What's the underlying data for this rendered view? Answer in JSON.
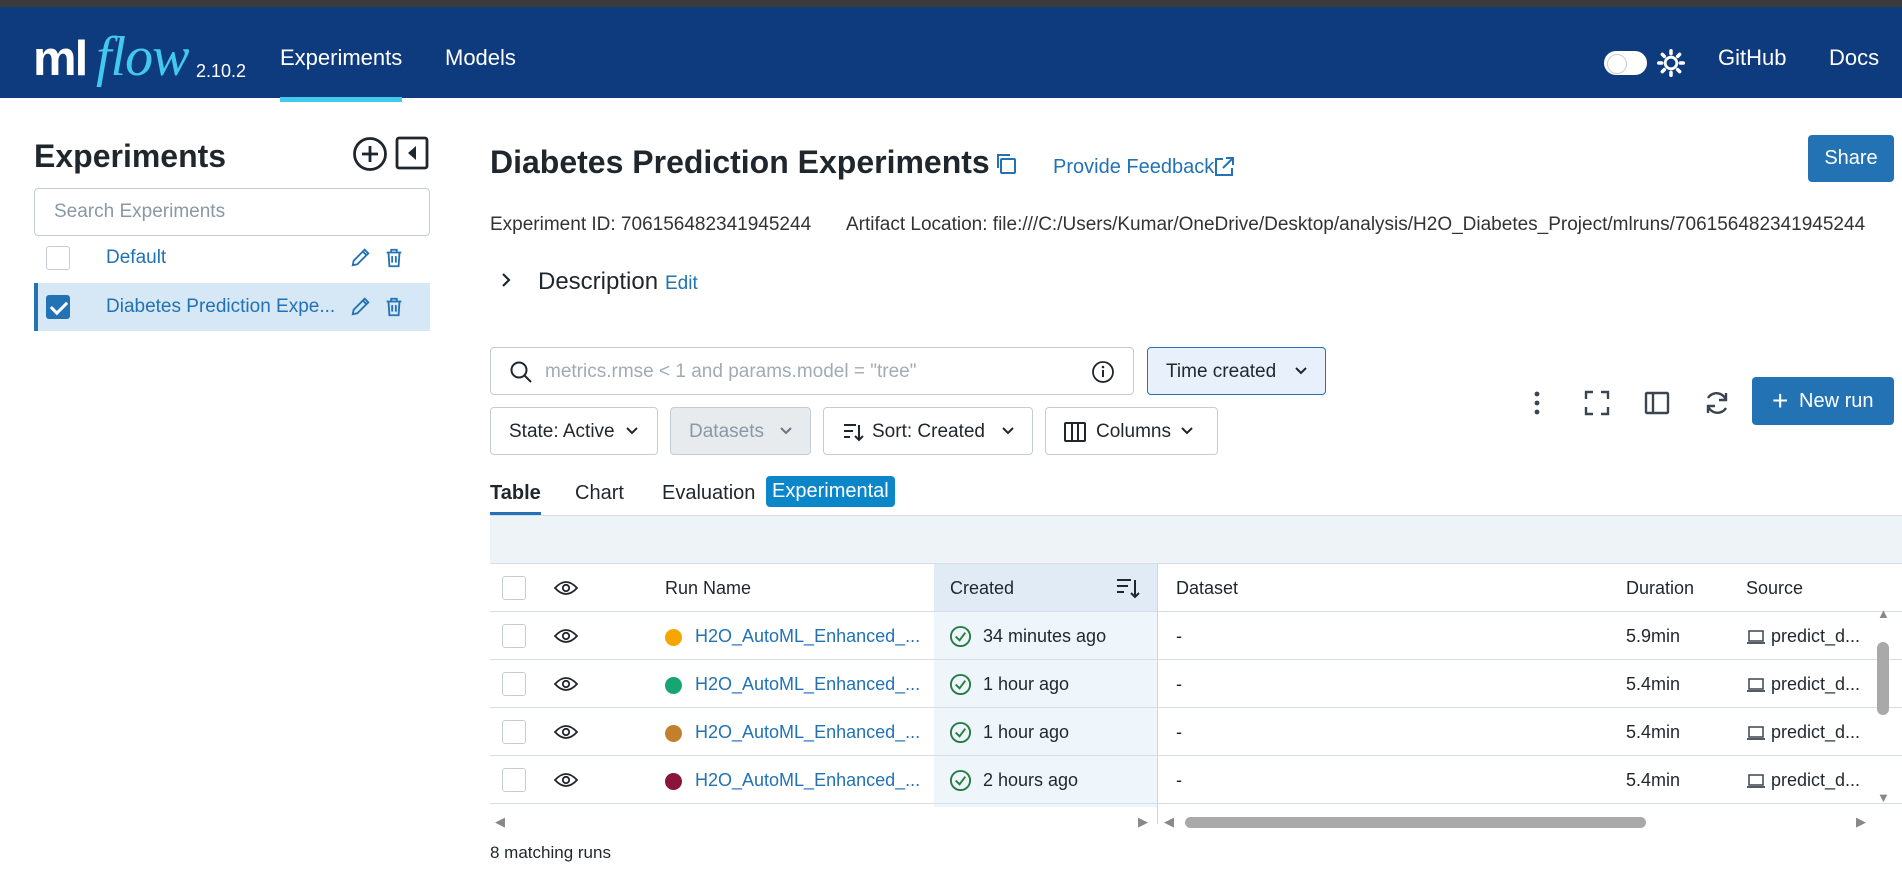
{
  "header": {
    "logo_ml": "ml",
    "logo_flow": "flow",
    "version": "2.10.2",
    "nav": [
      {
        "label": "Experiments",
        "active": true
      },
      {
        "label": "Models",
        "active": false
      }
    ],
    "links": [
      "GitHub",
      "Docs"
    ],
    "dark_mode": false,
    "colors": {
      "bar": "#0e3b7e",
      "accent": "#43c9ed"
    }
  },
  "sidebar": {
    "title": "Experiments",
    "search_placeholder": "Search Experiments",
    "items": [
      {
        "label": "Default",
        "selected": false
      },
      {
        "label": "Diabetes Prediction Expe...",
        "selected": true
      }
    ]
  },
  "experiment": {
    "title": "Diabetes Prediction Experiments",
    "feedback": "Provide Feedback",
    "share": "Share",
    "id_label": "Experiment ID: 706156482341945244",
    "artifact_label": "Artifact Location: file:///C:/Users/Kumar/OneDrive/Desktop/analysis/H2O_Diabetes_Project/mlruns/706156482341945244",
    "description": "Description",
    "edit": "Edit"
  },
  "toolbar": {
    "search_placeholder": "metrics.rmse < 1 and params.model = \"tree\"",
    "time_created": "Time created",
    "state": "State: Active",
    "datasets": "Datasets",
    "sort": "Sort: Created",
    "columns": "Columns",
    "new_run": "New run"
  },
  "tabs": [
    "Table",
    "Chart",
    "Evaluation"
  ],
  "experimental_badge": "Experimental",
  "table": {
    "columns": [
      "Run Name",
      "Created",
      "Dataset",
      "Duration",
      "Source"
    ],
    "rows": [
      {
        "name": "H2O_AutoML_Enhanced_...",
        "color": "#f7a600",
        "created": "34 minutes ago",
        "dataset": "-",
        "duration": "5.9min",
        "source": "predict_d..."
      },
      {
        "name": "H2O_AutoML_Enhanced_...",
        "color": "#17a673",
        "created": "1 hour ago",
        "dataset": "-",
        "duration": "5.4min",
        "source": "predict_d..."
      },
      {
        "name": "H2O_AutoML_Enhanced_...",
        "color": "#c2802c",
        "created": "1 hour ago",
        "dataset": "-",
        "duration": "5.4min",
        "source": "predict_d..."
      },
      {
        "name": "H2O_AutoML_Enhanced_...",
        "color": "#8a1538",
        "created": "2 hours ago",
        "dataset": "-",
        "duration": "5.4min",
        "source": "predict_d..."
      }
    ]
  },
  "matching_runs": "8 matching runs"
}
